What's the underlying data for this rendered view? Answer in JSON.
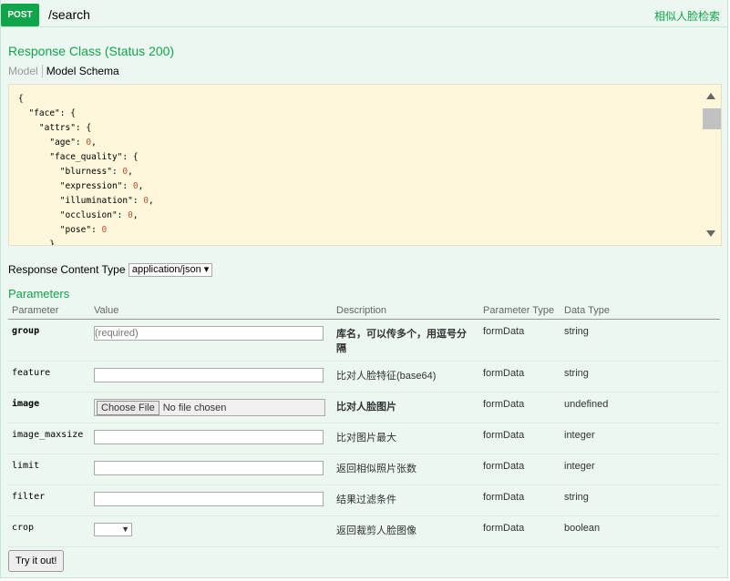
{
  "header": {
    "method": "POST",
    "path": "/search",
    "summary": "相似人脸检索"
  },
  "response_class": {
    "title": "Response Class (Status 200)",
    "tab_model": "Model",
    "tab_schema": "Model Schema"
  },
  "schema_lines": [
    "{",
    "  \"face\": {",
    "    \"attrs\": {",
    "      \"age\": 0,",
    "      \"face_quality\": {",
    "        \"blurness\": 0,",
    "        \"expression\": 0,",
    "        \"illumination\": 0,",
    "        \"occlusion\": 0,",
    "        \"pose\": 0",
    "      },"
  ],
  "response_content_type": {
    "label": "Response Content Type",
    "value": "application/json"
  },
  "parameters": {
    "title": "Parameters",
    "headers": [
      "Parameter",
      "Value",
      "Description",
      "Parameter Type",
      "Data Type"
    ],
    "rows": [
      {
        "name": "group",
        "placeholder": "(required)",
        "description": "库名，可以传多个，用逗号分隔",
        "param_type": "formData",
        "data_type": "string",
        "required": true,
        "input": "text"
      },
      {
        "name": "feature",
        "placeholder": "",
        "description": "比对人脸特征(base64)",
        "param_type": "formData",
        "data_type": "string",
        "required": false,
        "input": "text"
      },
      {
        "name": "image",
        "file_button": "Choose File",
        "file_status": "No file chosen",
        "description": "比对人脸图片",
        "param_type": "formData",
        "data_type": "undefined",
        "required": true,
        "input": "file"
      },
      {
        "name": "image_maxsize",
        "placeholder": "",
        "description": "比对图片最大",
        "param_type": "formData",
        "data_type": "integer",
        "required": false,
        "input": "text"
      },
      {
        "name": "limit",
        "placeholder": "",
        "description": "返回相似照片张数",
        "param_type": "formData",
        "data_type": "integer",
        "required": false,
        "input": "text"
      },
      {
        "name": "filter",
        "placeholder": "",
        "description": "结果过滤条件",
        "param_type": "formData",
        "data_type": "string",
        "required": false,
        "input": "text"
      },
      {
        "name": "crop",
        "description": "返回裁剪人脸图像",
        "param_type": "formData",
        "data_type": "boolean",
        "required": false,
        "input": "select"
      }
    ]
  },
  "try_button": "Try it out!"
}
